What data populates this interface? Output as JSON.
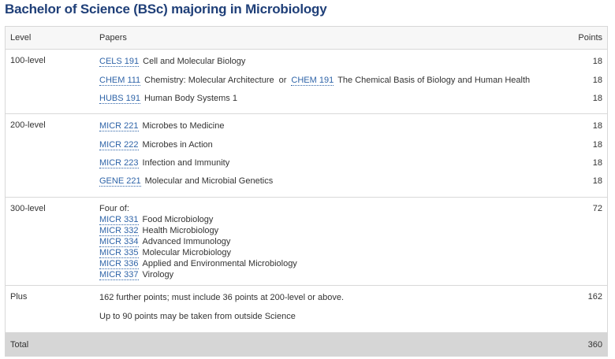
{
  "title": "Bachelor of Science (BSc) majoring in Microbiology",
  "headers": {
    "level": "Level",
    "papers": "Papers",
    "points": "Points"
  },
  "sections": [
    {
      "level": "100-level",
      "items": [
        {
          "code": "CELS 191",
          "name": "Cell and Molecular Biology",
          "points": "18"
        },
        {
          "code": "CHEM 111",
          "name": "Chemistry: Molecular Architecture",
          "or": "or",
          "code2": "CHEM 191",
          "name2": "The Chemical Basis of Biology and Human Health",
          "points": "18"
        },
        {
          "code": "HUBS 191",
          "name": "Human Body Systems 1",
          "points": "18"
        }
      ]
    },
    {
      "level": "200-level",
      "items": [
        {
          "code": "MICR 221",
          "name": "Microbes to Medicine",
          "points": "18"
        },
        {
          "code": "MICR 222",
          "name": "Microbes in Action",
          "points": "18"
        },
        {
          "code": "MICR 223",
          "name": "Infection and Immunity",
          "points": "18"
        },
        {
          "code": "GENE 221",
          "name": "Molecular and Microbial Genetics",
          "points": "18"
        }
      ]
    },
    {
      "level": "300-level",
      "intro": "Four of:",
      "points": "72",
      "items": [
        {
          "code": "MICR 331",
          "name": "Food Microbiology"
        },
        {
          "code": "MICR 332",
          "name": "Health Microbiology"
        },
        {
          "code": "MICR 334",
          "name": "Advanced Immunology"
        },
        {
          "code": "MICR 335",
          "name": "Molecular Microbiology"
        },
        {
          "code": "MICR 336",
          "name": "Applied and Environmental Microbiology"
        },
        {
          "code": "MICR 337",
          "name": "Virology"
        }
      ]
    },
    {
      "level": "Plus",
      "points": "162",
      "notes": [
        "162 further points; must include 36 points at 200-level or above.",
        "Up to 90 points may be taken from outside Science"
      ]
    }
  ],
  "total": {
    "label": "Total",
    "points": "360"
  }
}
